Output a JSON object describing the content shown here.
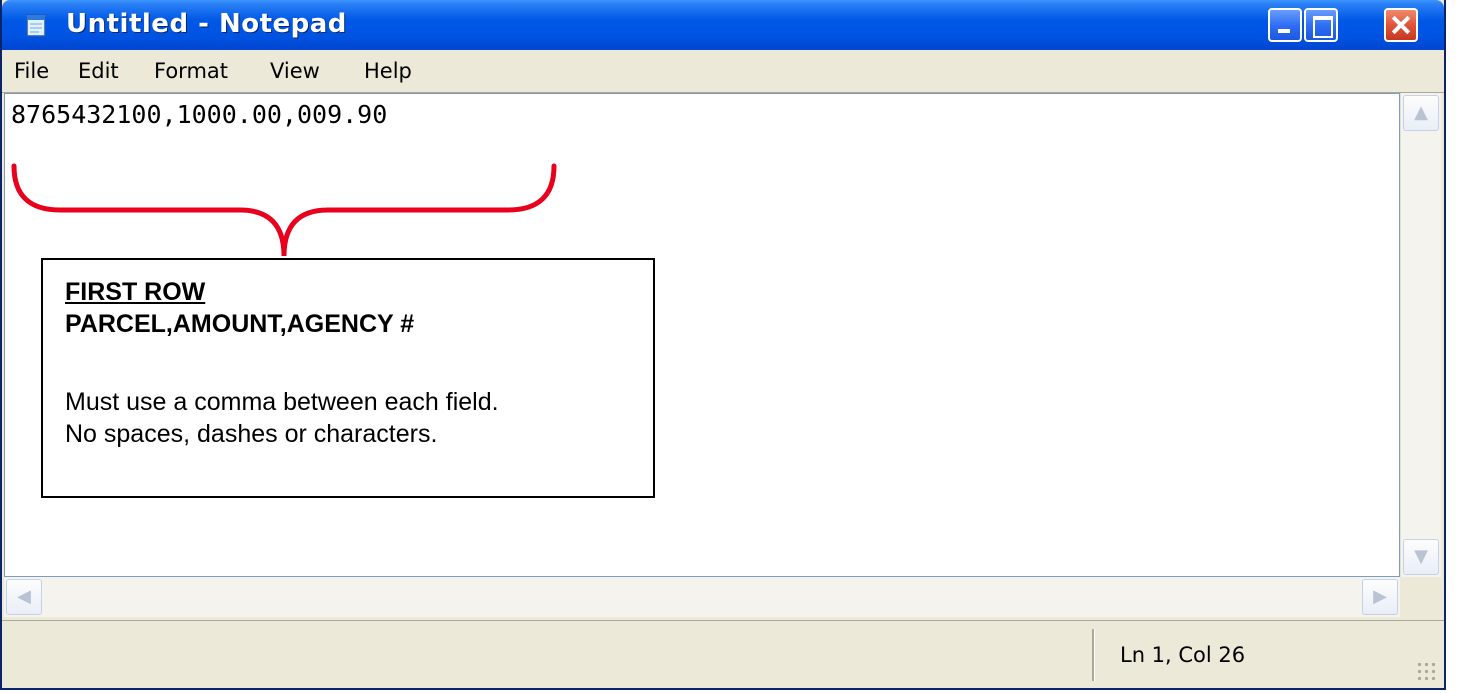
{
  "window": {
    "title": "Untitled - Notepad"
  },
  "menu": {
    "items": [
      "File",
      "Edit",
      "Format",
      "View",
      "Help"
    ]
  },
  "editor": {
    "content": "8765432100,1000.00,009.90"
  },
  "status": {
    "position": "Ln 1, Col 26"
  },
  "annotation": {
    "heading": "FIRST ROW",
    "fields": "PARCEL,AMOUNT,AGENCY #",
    "note_line1": "Must use a comma between each field.",
    "note_line2": "No spaces, dashes or characters.",
    "brace_color": "#e8001c"
  },
  "icons": {
    "app": "notepad-icon",
    "minimize": "minimize-icon",
    "maximize": "maximize-icon",
    "close": "close-icon",
    "scroll_up": "arrow-up-icon",
    "scroll_down": "arrow-down-icon",
    "scroll_left": "arrow-left-icon",
    "scroll_right": "arrow-right-icon",
    "grip": "resize-grip-icon"
  }
}
